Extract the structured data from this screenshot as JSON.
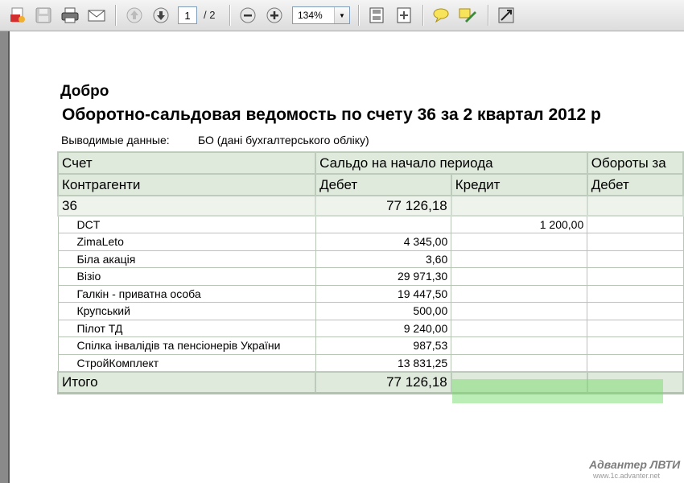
{
  "toolbar": {
    "page_current": "1",
    "page_total": "/ 2",
    "zoom": "134%",
    "icons": [
      "create-pdf-icon",
      "save-icon",
      "print-icon",
      "email-icon",
      "previous-page-icon",
      "next-page-icon",
      "zoom-out-icon",
      "zoom-in-icon",
      "fit-page-icon",
      "fit-width-icon",
      "comment-icon",
      "highlight-icon",
      "fullscreen-icon"
    ]
  },
  "document": {
    "org": "Добро",
    "title": "Оборотно-сальдовая ведомость по счету 36 за 2 квартал 2012 р",
    "output_label": "Выводимые данные:",
    "output_value": "БО (дані бухгалтерського обліку)",
    "header1": {
      "account": "Счет",
      "opening_balance": "Сальдо на начало периода",
      "turnover": "Обороты за"
    },
    "header2": {
      "counterparties": "Контрагенти",
      "debit": "Дебет",
      "credit": "Кредит",
      "turnover_debit": "Дебет"
    },
    "group": {
      "account": "36",
      "debit": "77 126,18"
    },
    "rows": [
      {
        "name": "DCT",
        "debit": "",
        "credit": "1 200,00"
      },
      {
        "name": "ZimaLeto",
        "debit": "4 345,00",
        "credit": ""
      },
      {
        "name": "Біла акація",
        "debit": "3,60",
        "credit": ""
      },
      {
        "name": "Візіо",
        "debit": "29 971,30",
        "credit": ""
      },
      {
        "name": "Галкін - приватна особа",
        "debit": "19 447,50",
        "credit": ""
      },
      {
        "name": "Крупський",
        "debit": "500,00",
        "credit": ""
      },
      {
        "name": "Пілот ТД",
        "debit": "9 240,00",
        "credit": ""
      },
      {
        "name": "Спілка інвалідів та пенсіонерів України",
        "debit": "987,53",
        "credit": ""
      },
      {
        "name": "СтройКомплект",
        "debit": "13 831,25",
        "credit": ""
      }
    ],
    "total": {
      "label": "Итого",
      "debit": "77 126,18"
    }
  },
  "watermark": {
    "brand": "Адвантер ЛВТИ",
    "url": "www.1c.advanter.net"
  }
}
